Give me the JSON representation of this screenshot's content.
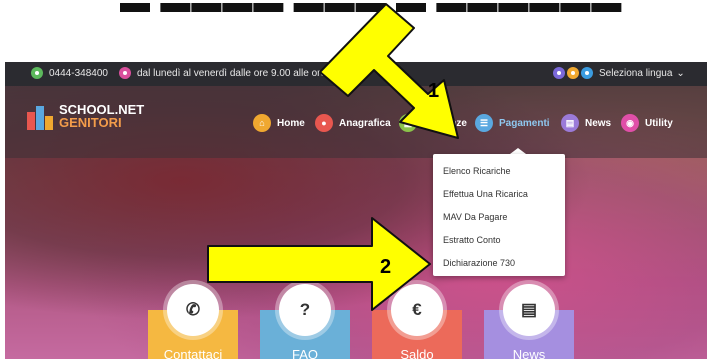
{
  "topbar": {
    "phone": "0444-348400",
    "hours": "dal lunedì al venerdì dalle ore 9.00 alle ore 10.00",
    "language_label": "Seleziona lingua",
    "colors": {
      "phone": "#5cb85c",
      "hours": "#d94f9c",
      "lang1": "#7a68d8",
      "lang2": "#f0a830",
      "lang3": "#3b9ce0"
    }
  },
  "logo": {
    "line1": "SCHOOL.NET",
    "line2": "GENITORI"
  },
  "nav": {
    "items": [
      {
        "label": "Home",
        "icon": "home-icon",
        "color": "#f0a830"
      },
      {
        "label": "Anagrafica",
        "icon": "user-icon",
        "color": "#e8574f"
      },
      {
        "label": "Presenze",
        "icon": "calendar-icon",
        "color": "#8bc34a"
      },
      {
        "label": "Pagamenti",
        "icon": "list-icon",
        "color": "#5aa8e0"
      },
      {
        "label": "News",
        "icon": "newspaper-icon",
        "color": "#9b7ad8"
      },
      {
        "label": "Utility",
        "icon": "eye-icon",
        "color": "#e04fa8"
      }
    ]
  },
  "dropdown": {
    "items": [
      "Elenco Ricariche",
      "Effettua Una Ricarica",
      "MAV Da Pagare",
      "Estratto Conto",
      "Dichiarazione 730"
    ]
  },
  "tiles": [
    {
      "label": "Contattaci",
      "glyph": "✆",
      "icon": "phone-icon",
      "color": "#f5b841"
    },
    {
      "label": "FAQ",
      "glyph": "?",
      "icon": "question-icon",
      "color": "#6ab0d8"
    },
    {
      "label": "Saldo",
      "glyph": "€",
      "icon": "euro-icon",
      "color": "#ec6a5a"
    },
    {
      "label": "News",
      "glyph": "▤",
      "icon": "newspaper-icon",
      "color": "#a58fe0"
    }
  ],
  "annotations": {
    "arrow1_number": "1",
    "arrow2_number": "2",
    "arrow_color": "#ffff00"
  }
}
